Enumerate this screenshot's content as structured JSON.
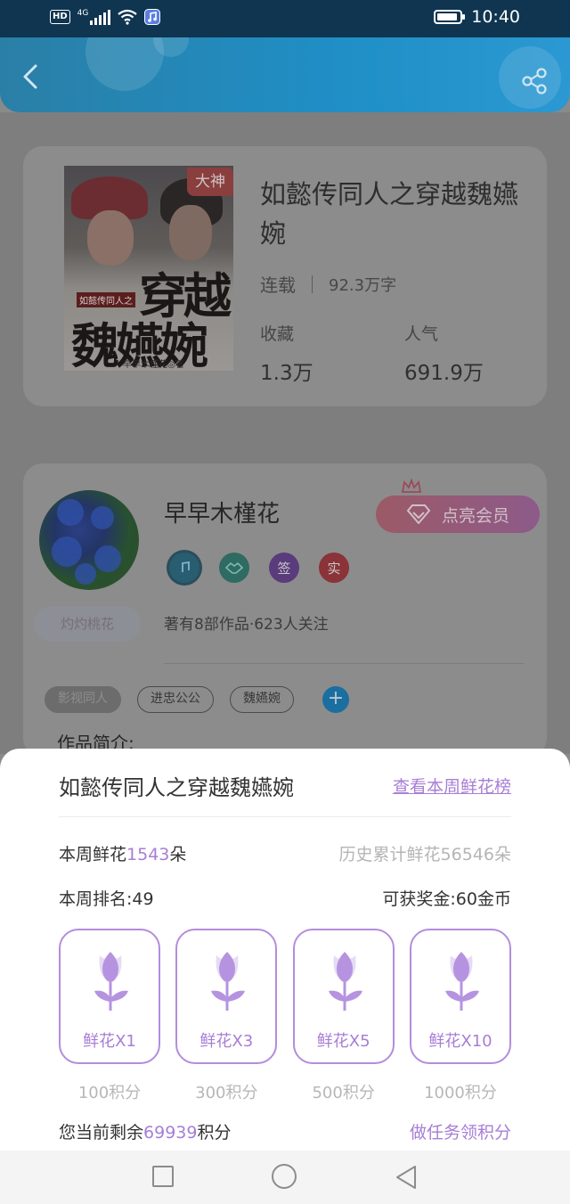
{
  "status_bar": {
    "hd": "HD",
    "network": "4G",
    "time": "10:40",
    "battery_level": 0.9
  },
  "header": {
    "back_icon": "chevron-left-icon",
    "share_icon": "share-icon"
  },
  "book": {
    "badge": "大神",
    "title": "如懿传同人之穿越魏嬿婉",
    "status": "连载",
    "word_count": "92.3万字",
    "favorites_label": "收藏",
    "favorites_value": "1.3万",
    "popularity_label": "人气",
    "popularity_value": "691.9万",
    "cover": {
      "small_title": "如懿传同人之",
      "title_line1": "穿越",
      "title_line2": "魏嬿婉",
      "author": "早早木槿花◎著"
    }
  },
  "author": {
    "name": "早早木槿花",
    "nickname_badge": "灼灼桃花",
    "vip_button": "点亮会员",
    "meta": "著有8部作品·623人关注",
    "badges": {
      "sign": "签",
      "real": "实"
    },
    "tags": [
      "影视同人",
      "进忠公公",
      "魏嬿婉"
    ],
    "add_tag": "+",
    "intro_label": "作品简介:"
  },
  "sheet": {
    "title": "如懿传同人之穿越魏嬿婉",
    "rank_link": "查看本周鲜花榜",
    "week_flowers_prefix": "本周鲜花",
    "week_flowers_value": "1543",
    "week_flowers_suffix": "朵",
    "total_flowers": "历史累计鲜花56546朵",
    "week_rank": "本周排名:49",
    "reward": "可获奖金:60金币",
    "options": [
      {
        "label": "鲜花X1",
        "price": "100积分"
      },
      {
        "label": "鲜花X3",
        "price": "300积分"
      },
      {
        "label": "鲜花X5",
        "price": "500积分"
      },
      {
        "label": "鲜花X10",
        "price": "1000积分"
      }
    ],
    "balance_prefix": "您当前剩余",
    "balance_value": "69939",
    "balance_suffix": "积分",
    "task_link": "做任务领积分"
  },
  "colors": {
    "accent_purple": "#a77ed6",
    "header_blue": "#1f8fc6",
    "status_bar": "#0f3550"
  }
}
